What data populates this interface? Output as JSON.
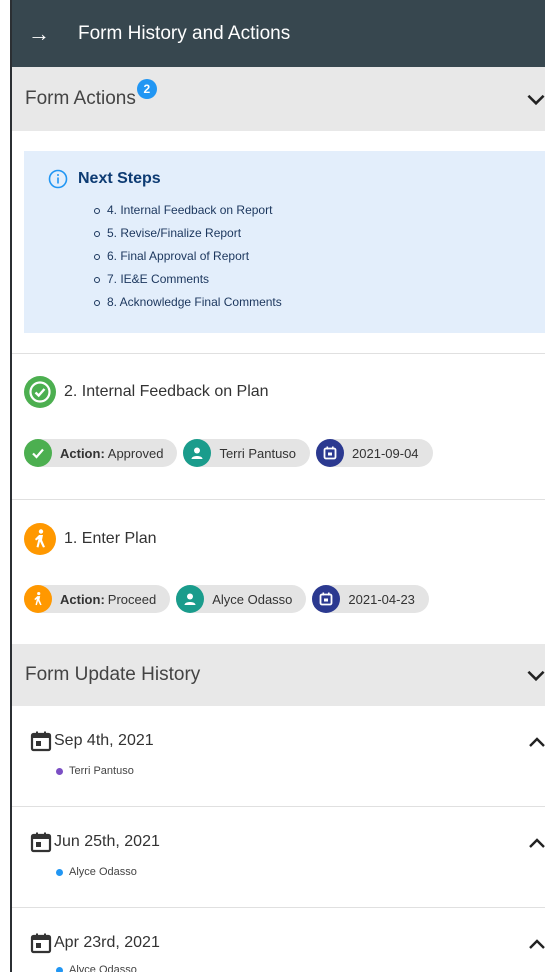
{
  "header": {
    "title": "Form History and Actions"
  },
  "form_actions": {
    "title": "Form Actions",
    "badge": "2",
    "next_steps": {
      "title": "Next Steps",
      "items": [
        "4. Internal Feedback on Report",
        "5. Revise/Finalize Report",
        "6. Final Approval of Report",
        "7. IE&E Comments",
        "8. Acknowledge Final Comments"
      ]
    },
    "steps": [
      {
        "title": "2. Internal Feedback on Plan",
        "action_label": "Action:",
        "action_value": "Approved",
        "user": "Terri Pantuso",
        "date": "2021-09-04",
        "color": "#4caf50"
      },
      {
        "title": "1. Enter Plan",
        "action_label": "Action:",
        "action_value": "Proceed",
        "user": "Alyce Odasso",
        "date": "2021-04-23",
        "color": "#ff9800"
      }
    ]
  },
  "update_history": {
    "title": "Form Update History",
    "items": [
      {
        "date": "Sep 4th, 2021",
        "user": "Terri Pantuso",
        "dot_color": "#7b4fc4"
      },
      {
        "date": "Jun 25th, 2021",
        "user": "Alyce Odasso",
        "dot_color": "#2196f3"
      },
      {
        "date": "Apr 23rd, 2021",
        "user": "Alyce Odasso",
        "dot_color": "#2196f3"
      }
    ]
  },
  "colors": {
    "header_bg": "#37474f",
    "user_icon": "#1a9c8c",
    "date_icon": "#2b3990"
  }
}
